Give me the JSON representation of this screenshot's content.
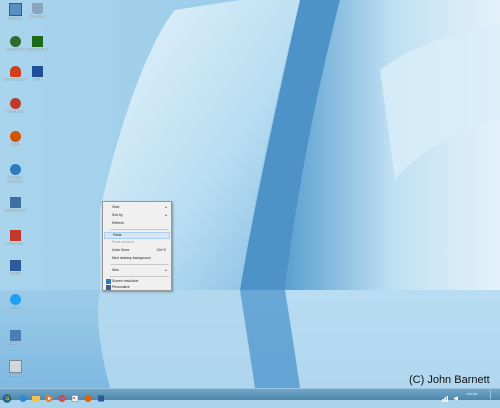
{
  "desktop": {
    "icons": [
      {
        "label": "Computer",
        "color": "#5a8fc4"
      },
      {
        "label": "Recycle Bin",
        "color": "#8aa6bd"
      },
      {
        "label": "Control Panel",
        "color": "#2f6b2f"
      },
      {
        "label": "Skype Desktop",
        "color": "#1a6a1a"
      },
      {
        "label": "VLC media player",
        "color": "#d04018"
      },
      {
        "label": "Word",
        "color": "#1e4f9a"
      },
      {
        "label": "SnagIt Editor",
        "color": "#c0392b"
      },
      {
        "label": "Firefox",
        "color": "#d35400"
      },
      {
        "label": "Advanced SystemCare",
        "color": "#2c7bbf"
      },
      {
        "label": "Advanced Office",
        "color": "#3f6fa0"
      },
      {
        "label": "MozBackup",
        "color": "#c0392b"
      },
      {
        "label": "Winamp",
        "color": "#2d5a9a"
      },
      {
        "label": "Skype",
        "color": "#1da1f2"
      },
      {
        "label": "PowerISO",
        "color": "#4a7fb5"
      },
      {
        "label": "Notepad",
        "color": "#cfd8dc"
      }
    ]
  },
  "context_menu": {
    "items": [
      {
        "label": "View",
        "submenu": true,
        "enabled": true
      },
      {
        "label": "Sort by",
        "submenu": true,
        "enabled": true
      },
      {
        "label": "Refresh",
        "enabled": true
      },
      {
        "label": "Paste",
        "enabled": true,
        "highlighted": true
      },
      {
        "label": "Paste shortcut",
        "enabled": false
      },
      {
        "label": "Undo Move",
        "shortcut": "Ctrl+Z",
        "enabled": true
      },
      {
        "label": "Next desktop background",
        "enabled": true
      },
      {
        "label": "New",
        "submenu": true,
        "enabled": true
      },
      {
        "label": "Screen resolution",
        "icon": "display-icon",
        "enabled": true
      },
      {
        "label": "Personalize",
        "icon": "personalize-icon",
        "enabled": true
      }
    ]
  },
  "taskbar": {
    "clock": "4:56 PM",
    "apps": [
      "start-orb",
      "internet-explorer",
      "file-explorer",
      "media-player",
      "chrome",
      "paint",
      "firefox",
      "word"
    ]
  },
  "watermark": "(C) John Barnett",
  "colors": {
    "accent": "#4d86aa",
    "ice_light": "#cfe8f6",
    "ice_dark": "#3f86c0"
  }
}
